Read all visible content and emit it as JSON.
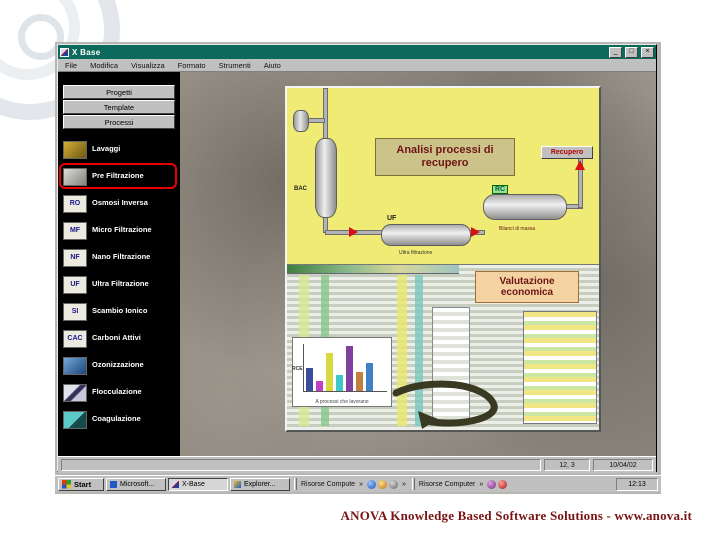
{
  "colors": {
    "titlebar": "#0c6a5c",
    "highlight": "#e80000",
    "footer": "#7a1414"
  },
  "window": {
    "title": "X Base",
    "controls": {
      "minimize": "_",
      "maximize": "□",
      "close": "×"
    },
    "menu": [
      "File",
      "Modifica",
      "Visualizza",
      "Formato",
      "Strumenti",
      "Aiuto"
    ],
    "nav_buttons": [
      "Progetti",
      "Template",
      "Processi"
    ],
    "process_items": [
      {
        "label": "Lavaggi",
        "icon": ""
      },
      {
        "label": "Pre Filtrazione",
        "icon": ""
      },
      {
        "label": "Osmosi Inversa",
        "icon": "RO"
      },
      {
        "label": "Micro Filtrazione",
        "icon": "MF"
      },
      {
        "label": "Nano Filtrazione",
        "icon": "NF"
      },
      {
        "label": "Ultra Filtrazione",
        "icon": "UF"
      },
      {
        "label": "Scambio Ionico",
        "icon": "SI"
      },
      {
        "label": "Carboni Attivi",
        "icon": "CAC"
      },
      {
        "label": "Ozonizzazione",
        "icon": ""
      },
      {
        "label": "Flocculazione",
        "icon": ""
      },
      {
        "label": "Coagulazione",
        "icon": ""
      }
    ],
    "status_cells": [
      "12, 3",
      "10/04/02"
    ]
  },
  "diagram": {
    "analysis_title": "Analisi processi di recupero",
    "recupero_button": "Recupero",
    "bac_label": "BAC",
    "rc_label": "RC",
    "uf_label": "UF",
    "mass_note": "Bilanci di massa",
    "uf_caption": "Ultra filtrazione",
    "economic_title": "Valutazione economica",
    "chart_ylabel": "RCE",
    "chart_caption": "A processi che lavorano",
    "chart_bars": [
      {
        "color": "#3b4da0",
        "h": 0.5
      },
      {
        "color": "#c040c0",
        "h": 0.22
      },
      {
        "color": "#d8d840",
        "h": 0.8
      },
      {
        "color": "#40c8c8",
        "h": 0.34
      },
      {
        "color": "#8040a0",
        "h": 0.95
      },
      {
        "color": "#c08040",
        "h": 0.4
      },
      {
        "color": "#4080c8",
        "h": 0.6
      }
    ]
  },
  "taskbar": {
    "start_label": "Start",
    "buttons": [
      "Microsoft...",
      "X-Base",
      "Explorer..."
    ],
    "tray_left_label": "Risorse Compute",
    "tray_right_label": "Risorse Computer",
    "chevron": "»",
    "clock": "12:13"
  },
  "footer": {
    "text": "ANOVA Knowledge Based Software Solutions  -  www.anova.it"
  }
}
